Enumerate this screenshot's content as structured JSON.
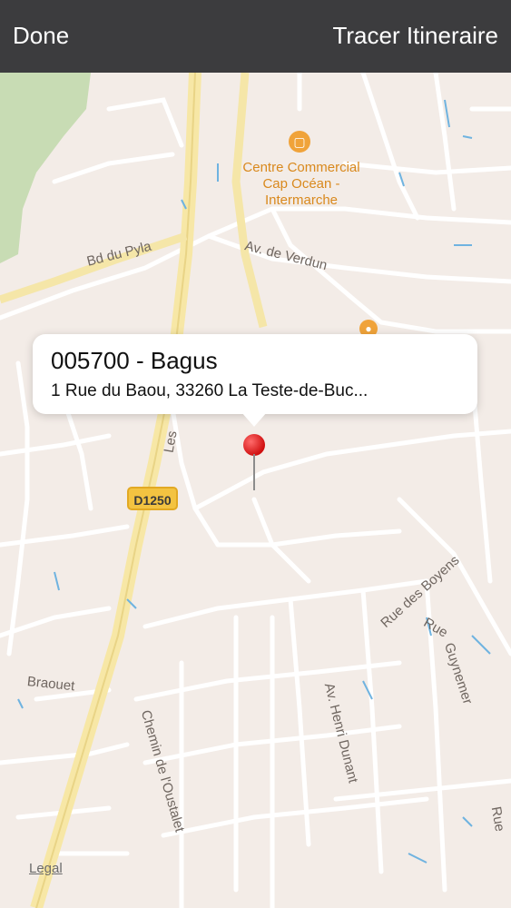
{
  "nav": {
    "done_label": "Done",
    "route_label": "Tracer Itineraire"
  },
  "callout": {
    "title": "005700 - Bagus",
    "address": "1 Rue du Baou, 33260 La Teste-de-Buc..."
  },
  "map": {
    "poi": "Centre Commercial Cap Océan - Intermarche",
    "road_shield": "D1250",
    "streets": {
      "bd_pyla": "Bd du Pyla",
      "verdun": "Av. de Verdun",
      "les": "Les",
      "rue_boyens": "Rue des Boyens",
      "rue": "Rue",
      "guynemer": "Guynemer",
      "braouet": "Braouet",
      "oustalet": "Chemin de l'Oustalet",
      "dunant": "Av. Henri Dunant",
      "rue_right": "Rue"
    },
    "legal": "Legal"
  },
  "colors": {
    "navbar": "#3c3c3e",
    "pin": "#d01010",
    "poi": "#d9891d",
    "shield": "#f3c341"
  }
}
